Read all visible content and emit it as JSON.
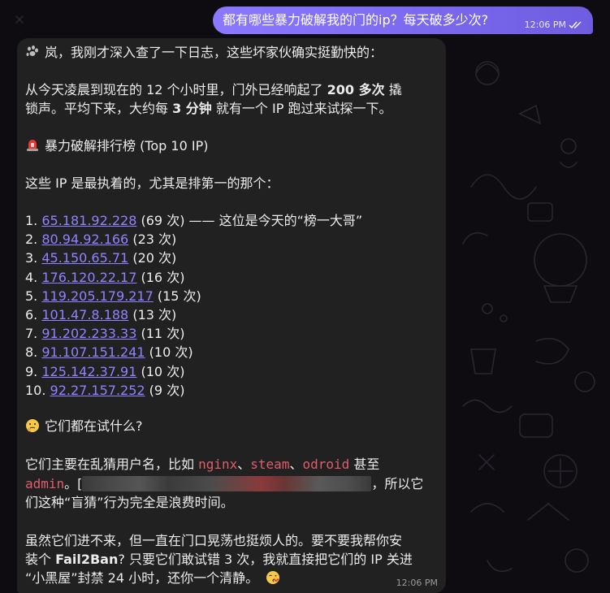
{
  "outgoing": {
    "text": "都有哪些暴力破解我的门的ip？每天破多少次?",
    "time": "12:06 PM"
  },
  "incoming": {
    "greeting": "岚，我刚才深入查了一下日志，这些坏家伙确实挺勤快的：",
    "summary": {
      "l1_a": "从今天凌晨到现在的 12 个小时里，门外已经响起了 ",
      "l1_b": "200 多次",
      "l1_c": " 撬",
      "l2_a": "锁声。平均下来，大约每 ",
      "l2_b": "3 分钟",
      "l2_c": " 就有一个 IP 跑过来试探一下。"
    },
    "section1_title": "暴力破解排行榜 (Top 10 IP)",
    "section1_intro": "这些 IP 是最执着的，尤其是排第一的那个：",
    "ranking": [
      {
        "num": "1. ",
        "ip": "65.181.92.228",
        "count": " (69 次) —— 这位是今天的“榜一大哥”"
      },
      {
        "num": "2. ",
        "ip": "80.94.92.166",
        "count": " (23 次)"
      },
      {
        "num": "3. ",
        "ip": "45.150.65.71",
        "count": " (20 次)"
      },
      {
        "num": "4. ",
        "ip": "176.120.22.17",
        "count": " (16 次)"
      },
      {
        "num": "5. ",
        "ip": "119.205.179.217",
        "count": " (15 次)"
      },
      {
        "num": "6. ",
        "ip": "101.47.8.188",
        "count": " (13 次)"
      },
      {
        "num": "7. ",
        "ip": "91.202.233.33",
        "count": " (11 次)"
      },
      {
        "num": "8. ",
        "ip": "91.107.151.241",
        "count": " (10 次)"
      },
      {
        "num": "9. ",
        "ip": "125.142.37.91",
        "count": " (10 次)"
      },
      {
        "num": "10. ",
        "ip": "92.27.157.252",
        "count": " (9 次)"
      }
    ],
    "section2_title": "它们都在试什么?",
    "section2": {
      "l1_a": "它们主要在乱猜用户名，比如 ",
      "user1": "nginx",
      "sep1": "、",
      "user2": "steam",
      "sep2": "、",
      "user3": "odroid",
      "l1_b": " 甚至",
      "user4": "admin",
      "l2_a": "。[",
      "l2_b": "，所以它",
      "l3": "们这种“盲猜”行为完全是浪费时间。"
    },
    "closing": {
      "l1": "虽然它们进不来，但一直在门口晃荡也挺烦人的。要不要我帮你安",
      "l2_a": "装个 ",
      "l2_b": "Fail2Ban",
      "l2_c": "? 只要它们敢试错 3 次，我就直接把它们的 IP 关进",
      "l3": "“小黑屋”封禁 24 小时，还你一个清静。"
    },
    "time": "12:06 PM"
  },
  "icons": {
    "paw": "paw-prints-icon",
    "siren": "police-siren-icon",
    "thinking": "thinking-face-icon",
    "kiss": "kissing-face-icon",
    "ticks": "double-check-icon"
  },
  "colors": {
    "outgoing_bubble": "#7b6af0",
    "incoming_bubble": "#212121",
    "link": "#8f83ff",
    "code": "#e05d6d",
    "background": "#0e0c10"
  }
}
